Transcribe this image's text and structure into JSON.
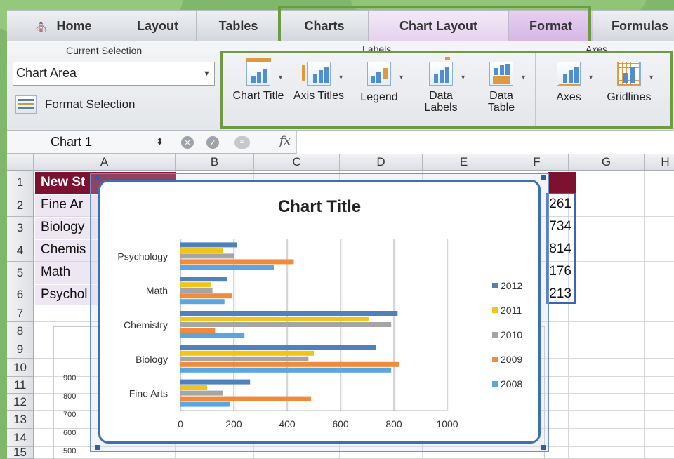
{
  "tabs": [
    {
      "label": "Home",
      "icon": "home-icon"
    },
    {
      "label": "Layout"
    },
    {
      "label": "Tables"
    },
    {
      "label": "Charts"
    },
    {
      "label": "Chart Layout"
    },
    {
      "label": "Format"
    },
    {
      "label": "Formulas"
    }
  ],
  "ribbon": {
    "current_selection": {
      "group_title": "Current Selection",
      "selected_value": "Chart Area",
      "format_selection_label": "Format Selection"
    },
    "labels_group_title": "Labels",
    "axes_group_title": "Axes",
    "buttons": [
      {
        "label": "Chart Title",
        "icon": "chart-title-icon"
      },
      {
        "label": "Axis Titles",
        "icon": "axis-titles-icon"
      },
      {
        "label": "Legend",
        "icon": "legend-icon"
      },
      {
        "label": "Data Labels",
        "icon": "data-labels-icon"
      },
      {
        "label": "Data Table",
        "icon": "data-table-icon"
      },
      {
        "label": "Axes",
        "icon": "axes-icon"
      },
      {
        "label": "Gridlines",
        "icon": "gridlines-icon"
      }
    ]
  },
  "formula_bar": {
    "name_box": "Chart 1",
    "fx": "fx"
  },
  "columns": [
    "A",
    "B",
    "C",
    "D",
    "E",
    "F",
    "G",
    "H"
  ],
  "rows": [
    "1",
    "2",
    "3",
    "4",
    "5",
    "6",
    "7",
    "8",
    "9",
    "10",
    "11",
    "12",
    "13",
    "14",
    "15"
  ],
  "cells": {
    "a1": "New St",
    "subjects": [
      "Fine Ar",
      "Biology",
      "Chemis",
      "Math",
      "Psychol"
    ],
    "col_f_values": [
      "261",
      "734",
      "814",
      "176",
      "213"
    ]
  },
  "hidden_chart_axis": [
    "900",
    "800",
    "700",
    "600",
    "500"
  ],
  "colors": {
    "accent_green": "#6f9a44",
    "header_maroon": "#7d1230"
  },
  "chart_data": {
    "type": "bar",
    "orientation": "horizontal",
    "title": "Chart Title",
    "categories": [
      "Fine Arts",
      "Biology",
      "Chemistry",
      "Math",
      "Psychology"
    ],
    "series": [
      {
        "name": "2012",
        "color": "#4f81bd",
        "values": [
          261,
          734,
          814,
          176,
          213
        ]
      },
      {
        "name": "2011",
        "color": "#f2c41a",
        "values": [
          100,
          500,
          705,
          115,
          160
        ]
      },
      {
        "name": "2010",
        "color": "#a5a5a5",
        "values": [
          160,
          480,
          790,
          120,
          200
        ]
      },
      {
        "name": "2009",
        "color": "#f08a3c",
        "values": [
          490,
          820,
          130,
          195,
          425
        ]
      },
      {
        "name": "2008",
        "color": "#5aa6e0",
        "values": [
          185,
          790,
          240,
          165,
          350
        ]
      }
    ],
    "xlim": [
      0,
      1000
    ],
    "x_ticks": [
      "0",
      "200",
      "400",
      "600",
      "800",
      "1000"
    ],
    "grid": "vertical",
    "legend": "right"
  }
}
